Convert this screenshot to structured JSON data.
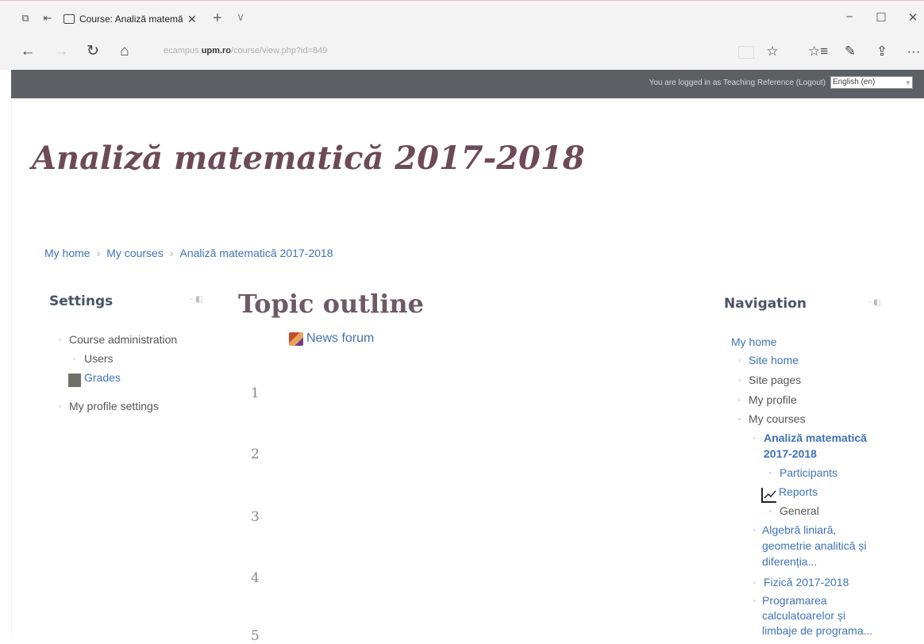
{
  "browser": {
    "tab_title": "Course: Analiză matemă",
    "tab_close": "✕",
    "new_tab": "+",
    "tab_menu": "∨",
    "win_minimize": "−",
    "win_restore": "☐",
    "win_close": "✕",
    "back": "←",
    "forward": "→",
    "refresh": "↻",
    "home": "⌂",
    "url_prefix": "ecampus.",
    "url_host": "upm.ro",
    "url_path": "/course/view.php?id=849",
    "favorite": "☆",
    "favorites_hub": "☆≡",
    "notes": "✎",
    "share": "⇪",
    "more": "···"
  },
  "header": {
    "login_text": "You are logged in as Teaching Reference (Logout)",
    "language": "English (en)",
    "language_arrow": "▾"
  },
  "course": {
    "title": "Analiză matematică 2017-2018"
  },
  "breadcrumb": {
    "items": [
      "My home",
      "My courses",
      "Analiză matematică 2017-2018"
    ],
    "separator": "›"
  },
  "settings": {
    "heading": "Settings",
    "toggle": "- ◧",
    "course_admin": "Course administration",
    "users": "Users",
    "grades": "Grades",
    "profile_settings": "My profile settings"
  },
  "main": {
    "heading": "Topic outline",
    "news_forum": "News forum",
    "sections": [
      "1",
      "2",
      "3",
      "4",
      "5"
    ]
  },
  "navigation": {
    "heading": "Navigation",
    "toggle": "- ◧",
    "my_home": "My home",
    "site_home": "Site home",
    "site_pages": "Site pages",
    "my_profile": "My profile",
    "my_courses": "My courses",
    "current_course_line1": "Analiză matematică",
    "current_course_line2": "2017-2018",
    "participants": "Participants",
    "reports": "Reports",
    "general": "General",
    "course2_line1": "Algebră liniară,",
    "course2_line2": "geometrie analitică și",
    "course2_line3": "diferenția...",
    "course3": "Fizică 2017-2018",
    "course4_line1": "Programarea",
    "course4_line2": "calculatoarelor și",
    "course4_line3": "limbaje de programa..."
  }
}
